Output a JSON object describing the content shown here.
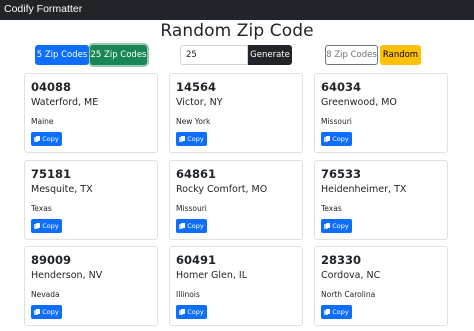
{
  "navbar": {
    "brand": "Codify Formatter"
  },
  "page": {
    "title": "Random Zip Code"
  },
  "toolbar": {
    "btn_5": "5 Zip Codes",
    "btn_25": "25 Zip Codes",
    "count_value": "25",
    "generate": "Generate",
    "btn_8": "8 Zip Codes",
    "random": "Random"
  },
  "cards": [
    {
      "zip": "04088",
      "city": "Waterford, ME",
      "state": "Maine",
      "copy": "Copy"
    },
    {
      "zip": "14564",
      "city": "Victor, NY",
      "state": "New York",
      "copy": "Copy"
    },
    {
      "zip": "64034",
      "city": "Greenwood, MO",
      "state": "Missouri",
      "copy": "Copy"
    },
    {
      "zip": "75181",
      "city": "Mesquite, TX",
      "state": "Texas",
      "copy": "Copy"
    },
    {
      "zip": "64861",
      "city": "Rocky Comfort, MO",
      "state": "Missouri",
      "copy": "Copy"
    },
    {
      "zip": "76533",
      "city": "Heidenheimer, TX",
      "state": "Texas",
      "copy": "Copy"
    },
    {
      "zip": "89009",
      "city": "Henderson, NV",
      "state": "Nevada",
      "copy": "Copy"
    },
    {
      "zip": "60491",
      "city": "Homer Glen, IL",
      "state": "Illinois",
      "copy": "Copy"
    },
    {
      "zip": "28330",
      "city": "Cordova, NC",
      "state": "North Carolina",
      "copy": "Copy"
    }
  ],
  "colors": {
    "navbar": "#212529",
    "primary": "#0d6efd",
    "success": "#198754",
    "warning": "#ffc107"
  }
}
